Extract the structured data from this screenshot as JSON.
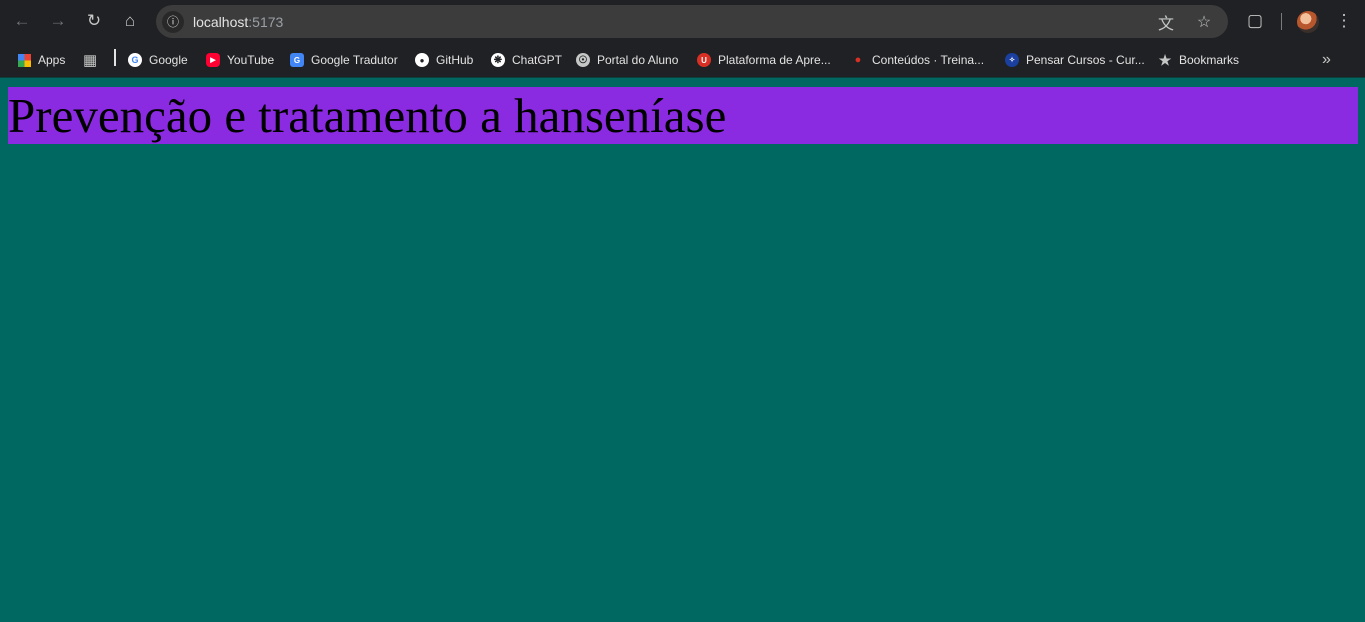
{
  "browser": {
    "url_host": "localhost",
    "url_port": ":5173",
    "bookmarks": [
      {
        "label": "Apps",
        "icon": "apps-grid-icon"
      },
      {
        "label": "Google",
        "icon": "google-icon"
      },
      {
        "label": "YouTube",
        "icon": "youtube-icon"
      },
      {
        "label": "Google Tradutor",
        "icon": "google-translate-icon"
      },
      {
        "label": "GitHub",
        "icon": "github-icon"
      },
      {
        "label": "ChatGPT",
        "icon": "chatgpt-icon"
      },
      {
        "label": "Portal do Aluno",
        "icon": "globe-icon"
      },
      {
        "label": "Plataforma de Apre...",
        "icon": "plataforma-icon"
      },
      {
        "label": "Conteúdos · Treina...",
        "icon": "pin-icon"
      },
      {
        "label": "Pensar Cursos - Cur...",
        "icon": "pensar-icon"
      },
      {
        "label": "Bookmarks",
        "icon": "star-icon"
      }
    ]
  },
  "page": {
    "heading": "Prevenção e tratamento a hanseníase"
  },
  "colors": {
    "page_background": "#006861",
    "heading_background": "#8a2be2"
  }
}
